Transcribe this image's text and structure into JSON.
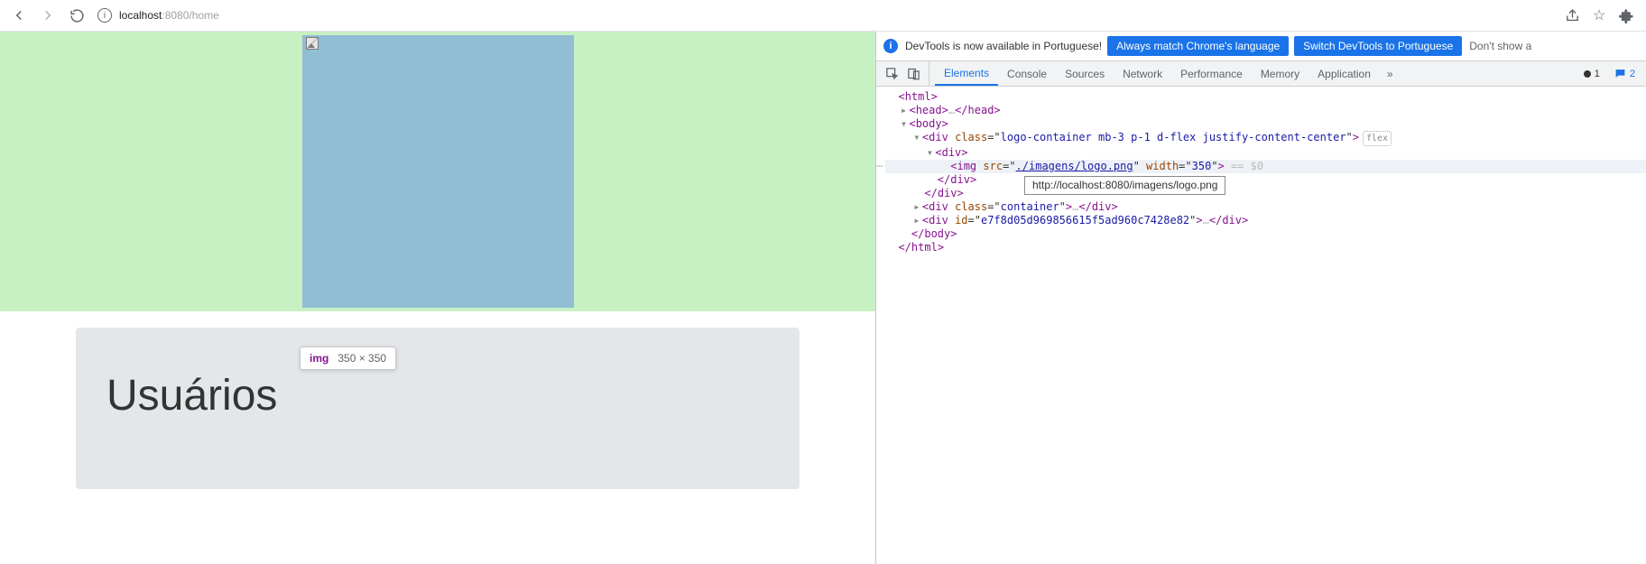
{
  "browser": {
    "url_prefix": "localhost",
    "url_port": ":8080",
    "url_path": "/home"
  },
  "page": {
    "inspector_tag": "img",
    "inspector_dims": "350 × 350",
    "card_title": "Usuários"
  },
  "devtools": {
    "banner_text": "DevTools is now available in Portuguese!",
    "banner_btn1": "Always match Chrome's language",
    "banner_btn2": "Switch DevTools to Portuguese",
    "banner_tail": "Don't show a",
    "tabs": [
      "Elements",
      "Console",
      "Sources",
      "Network",
      "Performance",
      "Memory",
      "Application"
    ],
    "err_count": "1",
    "msg_count": "2",
    "flex_badge": "flex",
    "dom": {
      "l1": "<html>",
      "l2_head": "<head>…</head>",
      "l3_body": "<body>",
      "l4_div_class": "logo-container mb-3 p-1 d-flex justify-content-center",
      "l5_div": "<div>",
      "l6_img_src": "./imagens/logo.png",
      "l6_img_w": "350",
      "l6_tail": " == $0",
      "l7": "</div>",
      "l8": "</div>",
      "l9_class": "container",
      "l10_id": "e7f8d05d969856615f5ad960c7428e82",
      "l11": "</body>",
      "l12": "</html>"
    },
    "url_tooltip": "http://localhost:8080/imagens/logo.png"
  }
}
